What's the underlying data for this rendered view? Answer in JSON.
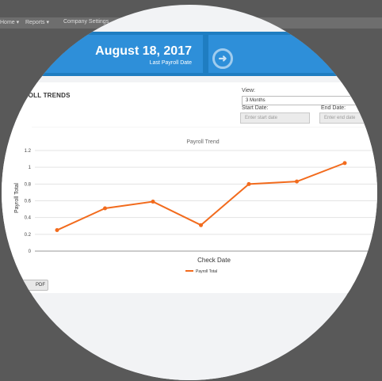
{
  "menu": {
    "items": [
      "Home ▾",
      "Reports ▾",
      "Company Settings"
    ]
  },
  "header": {
    "date": "August 18, 2017",
    "date_caption": "Last Payroll Date"
  },
  "section": {
    "title": "PAYROLL TRENDS"
  },
  "filters": {
    "view_label": "View:",
    "view_value": "3 Months",
    "start_label": "Start Date:",
    "start_placeholder": "Enter start date",
    "end_label": "End Date:",
    "end_placeholder": "Enter end date"
  },
  "pdf_button": {
    "label": "PDF"
  },
  "colors": {
    "accent": "#1f7dc1",
    "series": "#f26b1d"
  },
  "chart_data": {
    "type": "line",
    "title": "Payroll Trend",
    "xlabel": "Check Date",
    "ylabel": "Payroll Total",
    "ylim": [
      0,
      1.2
    ],
    "yticks": [
      "0",
      "0.2",
      "0.4",
      "0.6",
      "0.8",
      "1",
      "1.2"
    ],
    "grid": true,
    "legend": "bottom",
    "series": [
      {
        "name": "Payroll Total",
        "values": [
          0.25,
          0.51,
          0.59,
          0.31,
          0.8,
          0.83,
          1.05
        ]
      }
    ]
  }
}
